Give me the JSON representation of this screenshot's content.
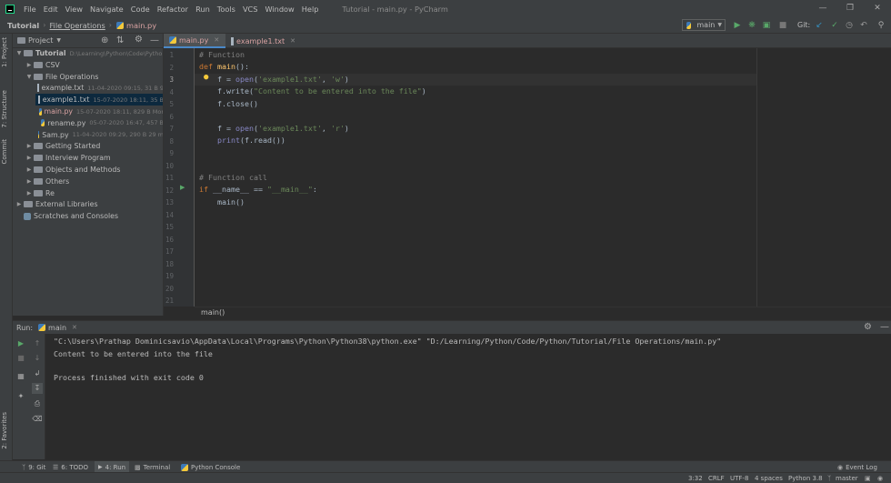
{
  "menu": {
    "items": [
      "File",
      "Edit",
      "View",
      "Navigate",
      "Code",
      "Refactor",
      "Run",
      "Tools",
      "VCS",
      "Window",
      "Help"
    ],
    "window_title": "Tutorial - main.py - PyCharm"
  },
  "navbar": {
    "breadcrumbs": [
      "Tutorial",
      "File Operations",
      "main.py"
    ],
    "run_config": "main",
    "git_label": "Git:"
  },
  "left_strip": {
    "tabs": [
      "1: Project",
      "7: Structure",
      "Commit",
      "2: Favorites"
    ]
  },
  "project": {
    "header": "Project",
    "tree": [
      {
        "label": "Tutorial",
        "meta": "D:\\Learning\\Python\\Code\\Pytho",
        "type": "folder",
        "depth": 0,
        "open": true
      },
      {
        "label": "CSV",
        "meta": "",
        "type": "folder",
        "depth": 1,
        "open": false
      },
      {
        "label": "File Operations",
        "meta": "",
        "type": "folder",
        "depth": 1,
        "open": true
      },
      {
        "label": "example.txt",
        "meta": "11-04-2020 09:15, 31 B 9",
        "type": "txt",
        "depth": 2
      },
      {
        "label": "example1.txt",
        "meta": "15-07-2020 18:11, 35 B",
        "type": "txt",
        "depth": 2,
        "selected": true
      },
      {
        "label": "main.py",
        "meta": "15-07-2020 18:11, 829 B Mor",
        "type": "py",
        "depth": 2
      },
      {
        "label": "rename.py",
        "meta": "05-07-2020 16:47, 457 B",
        "type": "py",
        "depth": 2
      },
      {
        "label": "Sam.py",
        "meta": "11-04-2020 09:29, 290 B 29 m",
        "type": "py",
        "depth": 2
      },
      {
        "label": "Getting Started",
        "meta": "",
        "type": "folder",
        "depth": 1,
        "open": false
      },
      {
        "label": "Interview Program",
        "meta": "",
        "type": "folder",
        "depth": 1,
        "open": false
      },
      {
        "label": "Objects and Methods",
        "meta": "",
        "type": "folder",
        "depth": 1,
        "open": false
      },
      {
        "label": "Others",
        "meta": "",
        "type": "folder",
        "depth": 1,
        "open": false
      },
      {
        "label": "Re",
        "meta": "",
        "type": "folder",
        "depth": 1,
        "open": false
      },
      {
        "label": "External Libraries",
        "meta": "",
        "type": "lib",
        "depth": 0,
        "open": false
      },
      {
        "label": "Scratches and Consoles",
        "meta": "",
        "type": "scratch",
        "depth": 0
      }
    ]
  },
  "editor": {
    "tabs": [
      {
        "label": "main.py",
        "active": true
      },
      {
        "label": "example1.txt",
        "active": false
      }
    ],
    "line_numbers": [
      "1",
      "2",
      "3",
      "4",
      "5",
      "6",
      "7",
      "8",
      "9",
      "10",
      "11",
      "12",
      "13",
      "14",
      "15",
      "16",
      "17",
      "18",
      "19",
      "20",
      "21"
    ],
    "breadcrumb": "main()"
  },
  "run_panel": {
    "label": "Run:",
    "config": "main",
    "output": [
      "\"C:\\Users\\Prathap Dominicsavio\\AppData\\Local\\Programs\\Python\\Python38\\python.exe\" \"D:/Learning/Python/Code/Python/Tutorial/File Operations/main.py\"",
      "Content to be entered into the file",
      "",
      "Process finished with exit code 0"
    ]
  },
  "bottom_bar": {
    "tabs": [
      "9: Git",
      "6: TODO",
      "4: Run",
      "Terminal",
      "Python Console"
    ],
    "event_log": "Event Log"
  },
  "status_bar": {
    "position": "3:32",
    "line_sep": "CRLF",
    "encoding": "UTF-8",
    "indent": "4 spaces",
    "interpreter": "Python 3.8",
    "branch": "master"
  },
  "colors": {
    "run_green": "#59a869",
    "selection_blue": "#0d293e",
    "keyword_orange": "#cc7832",
    "string_green": "#6a8759"
  }
}
